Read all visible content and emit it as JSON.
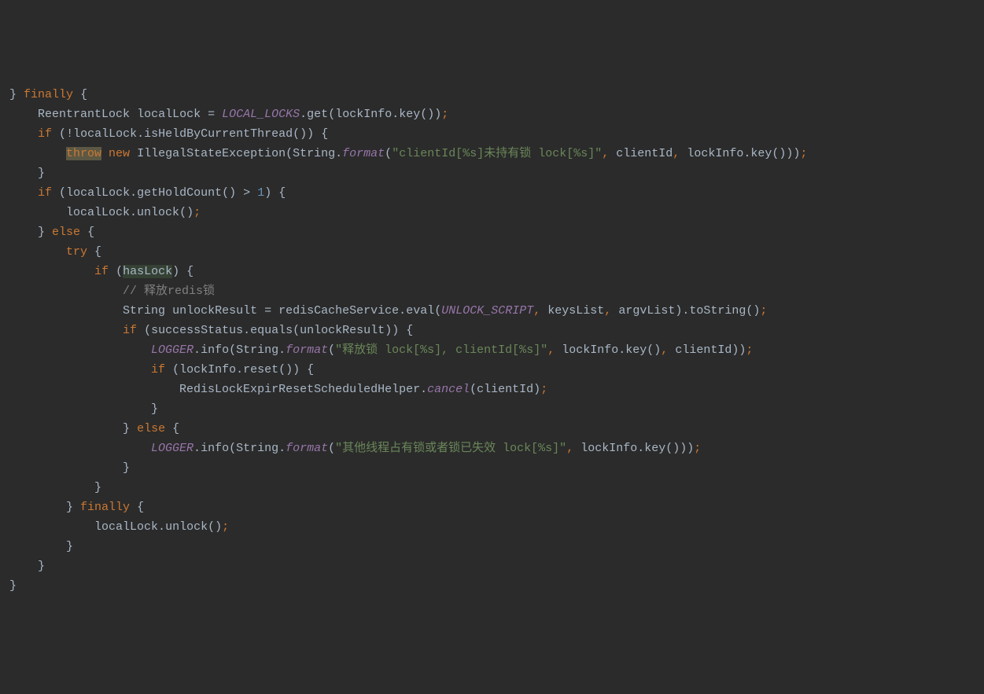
{
  "code": {
    "l1_brace": "}",
    "l1_finally": "finally",
    "l1_open": "{",
    "l2_type": "ReentrantLock",
    "l2_var": "localLock",
    "l2_eq": "=",
    "l2_const": "LOCAL_LOCKS",
    "l2_get": "get",
    "l2_lockinfo": "lockInfo",
    "l2_key": "key",
    "l3_if": "if",
    "l3_not": "!",
    "l3_var": "localLock",
    "l3_method": "isHeldByCurrentThread",
    "l4_throw": "throw",
    "l4_new": "new",
    "l4_exc": "IllegalStateException",
    "l4_string": "String",
    "l4_format": "format",
    "l4_msg": "\"clientId[%s]未持有锁 lock[%s]\"",
    "l4_arg1": "clientId",
    "l4_arg2": "lockInfo",
    "l4_key": "key",
    "l6_if": "if",
    "l6_var": "localLock",
    "l6_method": "getHoldCount",
    "l6_gt": ">",
    "l6_num": "1",
    "l7_var": "localLock",
    "l7_method": "unlock",
    "l8_else": "else",
    "l9_try": "try",
    "l10_if": "if",
    "l10_var": "hasLock",
    "l11_comment": "// 释放redis锁",
    "l12_type": "String",
    "l12_var": "unlockResult",
    "l12_eq": "=",
    "l12_svc": "redisCacheService",
    "l12_eval": "eval",
    "l12_script": "UNLOCK_SCRIPT",
    "l12_keys": "keysList",
    "l12_argv": "argvList",
    "l12_tostr": "toString",
    "l13_if": "if",
    "l13_status": "successStatus",
    "l13_equals": "equals",
    "l13_result": "unlockResult",
    "l14_logger": "LOGGER",
    "l14_info": "info",
    "l14_string": "String",
    "l14_format": "format",
    "l14_msg": "\"释放锁 lock[%s], clientId[%s]\"",
    "l14_lockinfo": "lockInfo",
    "l14_key": "key",
    "l14_client": "clientId",
    "l15_if": "if",
    "l15_lockinfo": "lockInfo",
    "l15_reset": "reset",
    "l16_helper": "RedisLockExpirResetScheduledHelper",
    "l16_cancel": "cancel",
    "l16_client": "clientId",
    "l18_else": "else",
    "l19_logger": "LOGGER",
    "l19_info": "info",
    "l19_string": "String",
    "l19_format": "format",
    "l19_msg": "\"其他线程占有锁或者锁已失效 lock[%s]\"",
    "l19_lockinfo": "lockInfo",
    "l19_key": "key",
    "l22_finally": "finally",
    "l23_var": "localLock",
    "l23_method": "unlock"
  }
}
